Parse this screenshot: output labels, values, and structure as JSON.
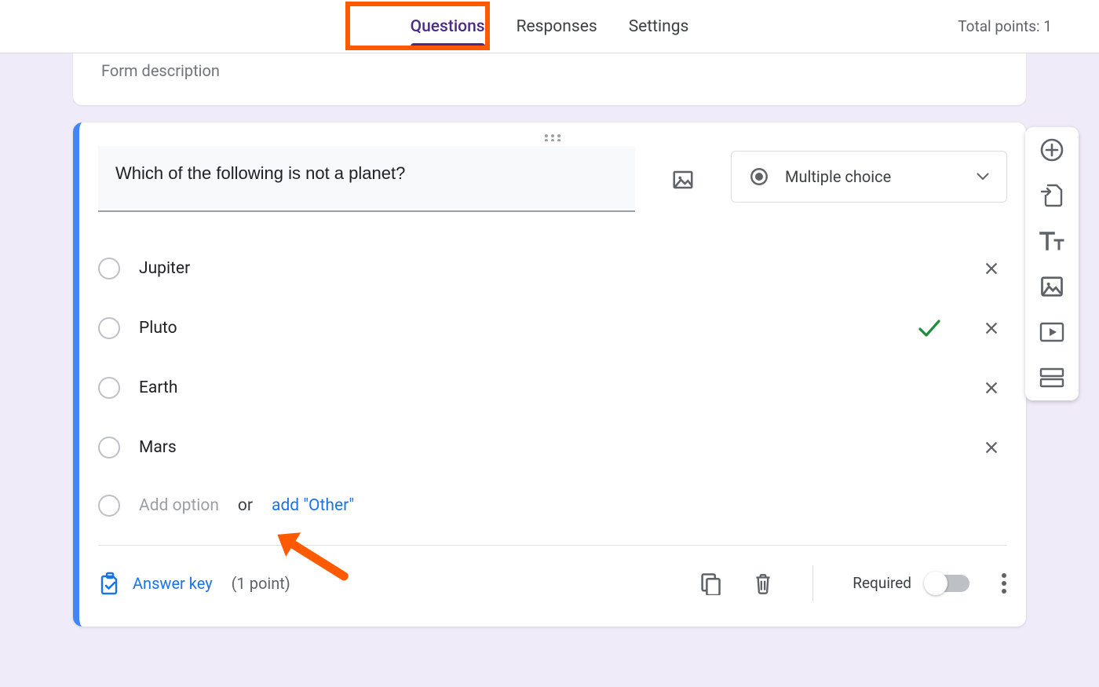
{
  "tabs": {
    "questions": "Questions",
    "responses": "Responses",
    "settings": "Settings"
  },
  "total_points_label": "Total points: 1",
  "header": {
    "description_placeholder": "Form description"
  },
  "question": {
    "title": "Which of the following is not a planet?",
    "type_label": "Multiple choice",
    "options": [
      {
        "label": "Jupiter",
        "correct": false
      },
      {
        "label": "Pluto",
        "correct": true
      },
      {
        "label": "Earth",
        "correct": false
      },
      {
        "label": "Mars",
        "correct": false
      }
    ],
    "add_option_placeholder": "Add option",
    "or_label": "or",
    "add_other_label": "add \"Other\""
  },
  "footer": {
    "answer_key_label": "Answer key",
    "points_label": "(1 point)",
    "required_label": "Required"
  },
  "toolbox": {
    "items": [
      "add-question",
      "import-questions",
      "add-title",
      "add-image",
      "add-video",
      "add-section"
    ]
  }
}
